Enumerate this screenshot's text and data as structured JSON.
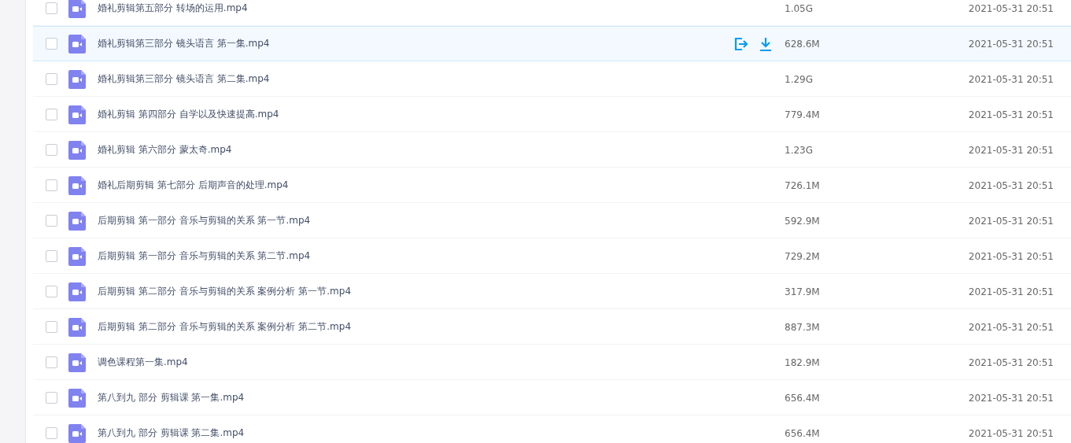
{
  "files": [
    {
      "name": "婚礼剪辑第五部分 转场的运用.mp4",
      "size": "1.05G",
      "date": "2021-05-31 20:51",
      "checked": false,
      "hovered": false
    },
    {
      "name": "婚礼剪辑第三部分 镜头语言 第一集.mp4",
      "size": "628.6M",
      "date": "2021-05-31 20:51",
      "checked": false,
      "hovered": true
    },
    {
      "name": "婚礼剪辑第三部分 镜头语言 第二集.mp4",
      "size": "1.29G",
      "date": "2021-05-31 20:51",
      "checked": false,
      "hovered": false
    },
    {
      "name": "婚礼剪辑 第四部分 自学以及快速提高.mp4",
      "size": "779.4M",
      "date": "2021-05-31 20:51",
      "checked": false,
      "hovered": false
    },
    {
      "name": "婚礼剪辑 第六部分 蒙太奇.mp4",
      "size": "1.23G",
      "date": "2021-05-31 20:51",
      "checked": false,
      "hovered": false
    },
    {
      "name": "婚礼后期剪辑 第七部分 后期声音的处理.mp4",
      "size": "726.1M",
      "date": "2021-05-31 20:51",
      "checked": false,
      "hovered": false
    },
    {
      "name": "后期剪辑 第一部分 音乐与剪辑的关系 第一节.mp4",
      "size": "592.9M",
      "date": "2021-05-31 20:51",
      "checked": false,
      "hovered": false
    },
    {
      "name": "后期剪辑 第一部分 音乐与剪辑的关系 第二节.mp4",
      "size": "729.2M",
      "date": "2021-05-31 20:51",
      "checked": false,
      "hovered": false
    },
    {
      "name": "后期剪辑 第二部分 音乐与剪辑的关系 案例分析 第一节.mp4",
      "size": "317.9M",
      "date": "2021-05-31 20:51",
      "checked": false,
      "hovered": false
    },
    {
      "name": "后期剪辑 第二部分 音乐与剪辑的关系 案例分析 第二节.mp4",
      "size": "887.3M",
      "date": "2021-05-31 20:51",
      "checked": false,
      "hovered": false
    },
    {
      "name": "调色课程第一集.mp4",
      "size": "182.9M",
      "date": "2021-05-31 20:51",
      "checked": false,
      "hovered": false
    },
    {
      "name": "第八到九 部分 剪辑课 第一集.mp4",
      "size": "656.4M",
      "date": "2021-05-31 20:51",
      "checked": false,
      "hovered": false
    },
    {
      "name": "第八到九 部分 剪辑课 第二集.mp4",
      "size": "656.4M",
      "date": "2021-05-31 20:51",
      "checked": false,
      "hovered": false
    }
  ]
}
